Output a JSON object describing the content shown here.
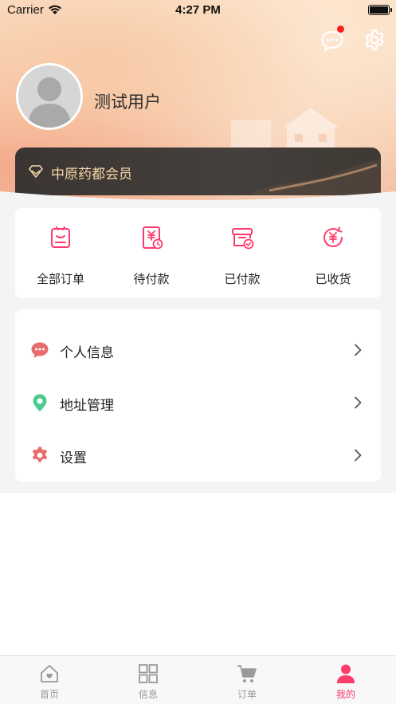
{
  "status_bar": {
    "carrier": "Carrier",
    "time": "4:27 PM"
  },
  "header": {
    "username": "测试用户",
    "member_label": "中原药都会员",
    "has_unread_message": true
  },
  "orders": [
    {
      "label": "全部订单",
      "icon": "all-orders-icon"
    },
    {
      "label": "待付款",
      "icon": "pending-payment-icon"
    },
    {
      "label": "已付款",
      "icon": "paid-icon"
    },
    {
      "label": "已收货",
      "icon": "received-icon"
    }
  ],
  "menu": [
    {
      "label": "个人信息",
      "icon": "chat-bubble-icon"
    },
    {
      "label": "地址管理",
      "icon": "location-pin-icon"
    },
    {
      "label": "设置",
      "icon": "gear-icon"
    }
  ],
  "tabbar": [
    {
      "label": "首页",
      "icon": "home-icon",
      "active": false
    },
    {
      "label": "信息",
      "icon": "grid-icon",
      "active": false
    },
    {
      "label": "订单",
      "icon": "cart-icon",
      "active": false
    },
    {
      "label": "我的",
      "icon": "profile-icon",
      "active": true
    }
  ],
  "colors": {
    "accent": "#ff3b6b",
    "member_text": "#f5d7a6",
    "member_card": "#3a3532",
    "location_green": "#4ccb8f",
    "chat_red": "#e96b6b"
  }
}
